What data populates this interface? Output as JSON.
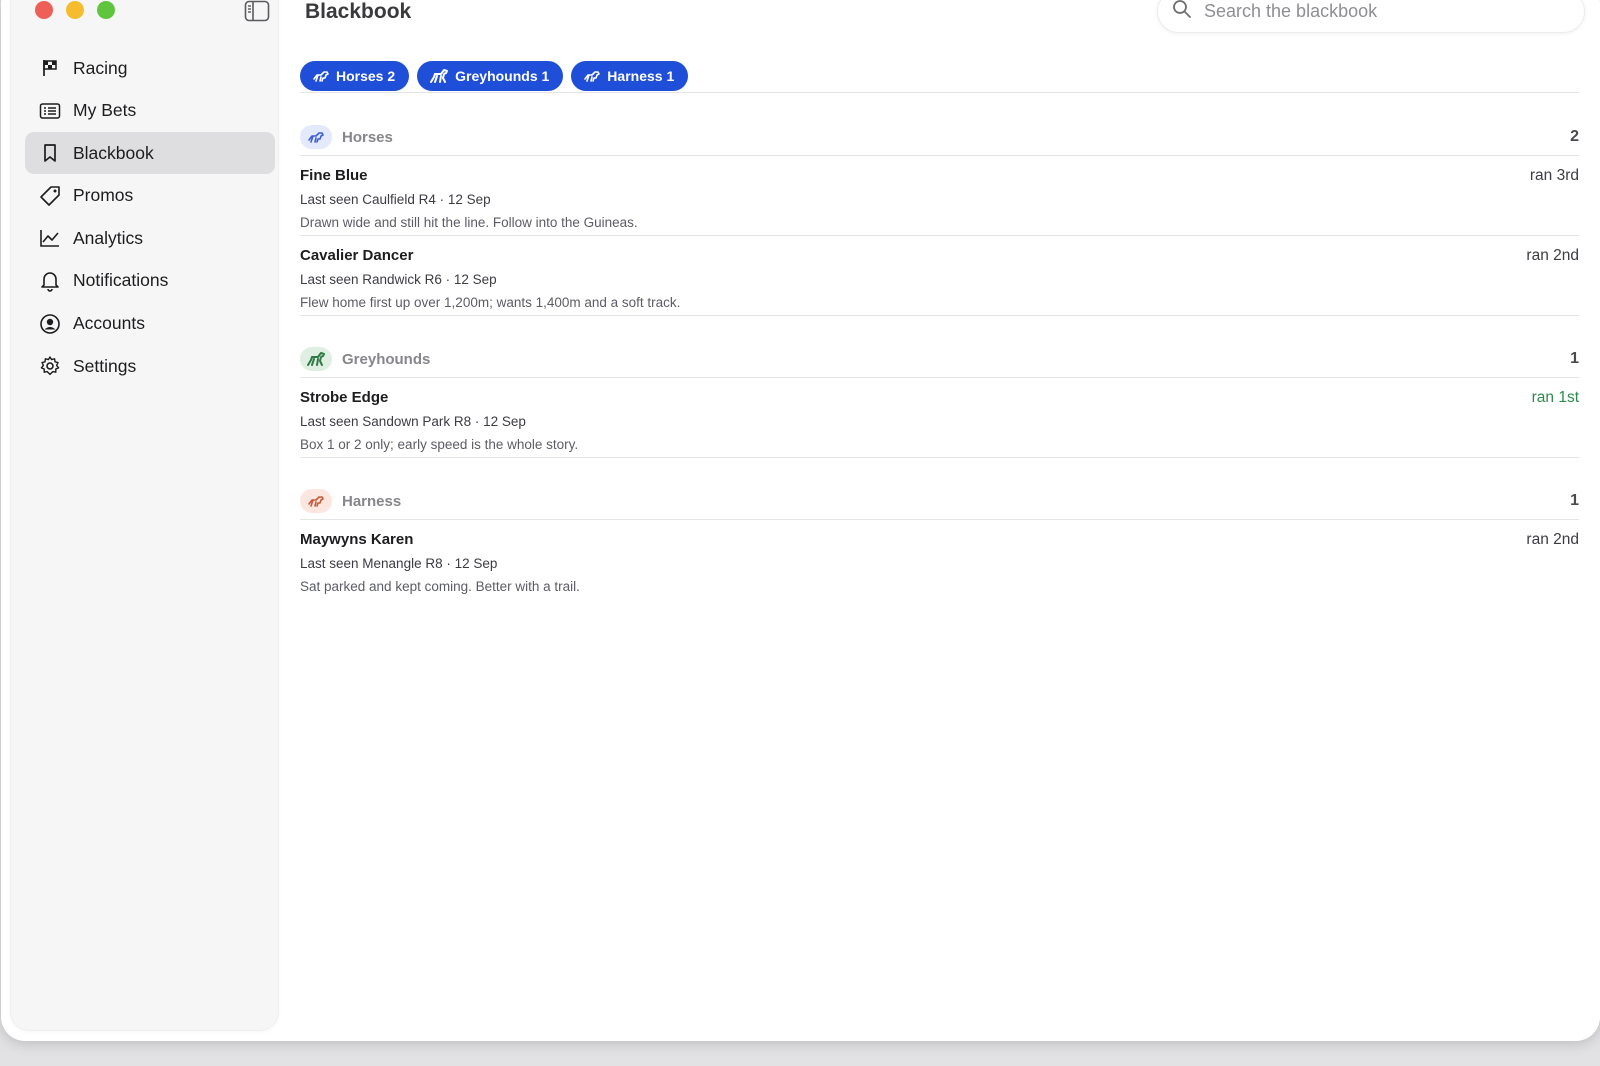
{
  "window": {
    "title": "Blackbook"
  },
  "sidebar": {
    "items": [
      {
        "label": "Racing",
        "icon": "flag-icon"
      },
      {
        "label": "My Bets",
        "icon": "list-icon"
      },
      {
        "label": "Blackbook",
        "icon": "bookmark-icon",
        "active": true
      },
      {
        "label": "Promos",
        "icon": "tag-icon"
      },
      {
        "label": "Analytics",
        "icon": "chart-icon"
      },
      {
        "label": "Notifications",
        "icon": "bell-icon"
      },
      {
        "label": "Accounts",
        "icon": "user-circle-icon"
      },
      {
        "label": "Settings",
        "icon": "gear-icon"
      }
    ]
  },
  "search": {
    "placeholder": "Search the blackbook"
  },
  "filters": [
    {
      "label": "Horses 2",
      "icon": "horse-icon"
    },
    {
      "label": "Greyhounds 1",
      "icon": "greyhound-icon"
    },
    {
      "label": "Harness 1",
      "icon": "harness-icon"
    }
  ],
  "sections": [
    {
      "name": "Horses",
      "count": "2",
      "entries": [
        {
          "name": "Fine Blue",
          "meta": "Last seen Caulfield R4 · 12 Sep",
          "note": "Drawn wide and still hit the line. Follow into the Guineas.",
          "result": "ran 3rd"
        },
        {
          "name": "Cavalier Dancer",
          "meta": "Last seen Randwick R6 · 12 Sep",
          "note": "Flew home first up over 1,200m; wants 1,400m and a soft track.",
          "result": "ran 2nd"
        }
      ]
    },
    {
      "name": "Greyhounds",
      "count": "1",
      "entries": [
        {
          "name": "Strobe Edge",
          "meta": "Last seen Sandown Park R8 · 12 Sep",
          "note": "Box 1 or 2 only; early speed is the whole story.",
          "result": "ran 1st"
        }
      ]
    },
    {
      "name": "Harness",
      "count": "1",
      "entries": [
        {
          "name": "Maywyns Karen",
          "meta": "Last seen Menangle R8 · 12 Sep",
          "note": "Sat parked and kept coming. Better with a trail.",
          "result": "ran 2nd"
        }
      ]
    }
  ],
  "colors": {
    "accent": "#1f4fd8",
    "win": "#2f8a4b",
    "horse_badge": "#e4e9fb",
    "greyhound_badge": "#dff0e3",
    "harness_badge": "#fbe7df"
  }
}
